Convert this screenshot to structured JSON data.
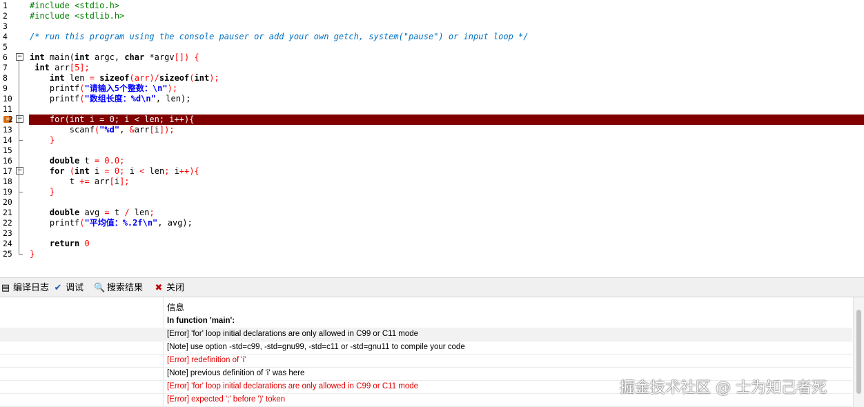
{
  "editor": {
    "lines": [
      {
        "n": "1",
        "segments": [
          {
            "t": "#include <stdio.h>",
            "c": "pp"
          }
        ]
      },
      {
        "n": "2",
        "segments": [
          {
            "t": "#include <stdlib.h>",
            "c": "pp"
          }
        ]
      },
      {
        "n": "3",
        "segments": []
      },
      {
        "n": "4",
        "segments": [
          {
            "t": "/* run this program using the console pauser or add your own getch, system(\"pause\") or input loop */",
            "c": "cm"
          }
        ]
      },
      {
        "n": "5",
        "segments": []
      },
      {
        "n": "6",
        "fold": "−",
        "segments": [
          {
            "t": "int",
            "c": "kw"
          },
          {
            "t": " main(",
            "c": ""
          },
          {
            "t": "int",
            "c": "kw"
          },
          {
            "t": " argc, ",
            "c": ""
          },
          {
            "t": "char",
            "c": "kw"
          },
          {
            "t": " *argv",
            "c": ""
          },
          {
            "t": "[])",
            "c": "sym"
          },
          {
            "t": " {",
            "c": "sym"
          }
        ]
      },
      {
        "n": "7",
        "segments": [
          {
            "t": " ",
            "c": ""
          },
          {
            "t": "int",
            "c": "kw"
          },
          {
            "t": " arr",
            "c": ""
          },
          {
            "t": "[",
            "c": "sym"
          },
          {
            "t": "5",
            "c": "num"
          },
          {
            "t": "];",
            "c": "sym"
          }
        ]
      },
      {
        "n": "8",
        "segments": [
          {
            "t": "    ",
            "c": ""
          },
          {
            "t": "int",
            "c": "kw"
          },
          {
            "t": " len ",
            "c": ""
          },
          {
            "t": "=",
            "c": "sym"
          },
          {
            "t": " ",
            "c": ""
          },
          {
            "t": "sizeof",
            "c": "fn"
          },
          {
            "t": "(arr)",
            "c": "sym"
          },
          {
            "t": "/",
            "c": "sym"
          },
          {
            "t": "sizeof",
            "c": "fn"
          },
          {
            "t": "(",
            "c": "sym"
          },
          {
            "t": "int",
            "c": "kw"
          },
          {
            "t": ");",
            "c": "sym"
          }
        ]
      },
      {
        "n": "9",
        "segments": [
          {
            "t": "    printf",
            "c": ""
          },
          {
            "t": "(",
            "c": "sym"
          },
          {
            "t": "\"请输入5个整数：\\n\"",
            "c": "str"
          },
          {
            "t": ");",
            "c": "sym"
          }
        ]
      },
      {
        "n": "10",
        "segments": [
          {
            "t": "    printf",
            "c": ""
          },
          {
            "t": "(",
            "c": "sym"
          },
          {
            "t": "\"数组长度：%d\\n\"",
            "c": "str"
          },
          {
            "t": ", len);",
            "c": ""
          }
        ]
      },
      {
        "n": "11",
        "segments": []
      },
      {
        "n": "12",
        "fold": "−",
        "error": true,
        "segments": [
          {
            "t": "    for(int i = 0; i < len; i++){",
            "c": ""
          }
        ]
      },
      {
        "n": "13",
        "segments": [
          {
            "t": "        scanf",
            "c": ""
          },
          {
            "t": "(",
            "c": "sym"
          },
          {
            "t": "\"%d\"",
            "c": "str"
          },
          {
            "t": ", ",
            "c": ""
          },
          {
            "t": "&",
            "c": "sym"
          },
          {
            "t": "arr",
            "c": ""
          },
          {
            "t": "[",
            "c": "sym"
          },
          {
            "t": "i",
            "c": ""
          },
          {
            "t": "]);",
            "c": "sym"
          }
        ]
      },
      {
        "n": "14",
        "segments": [
          {
            "t": "    ",
            "c": ""
          },
          {
            "t": "}",
            "c": "sym"
          }
        ]
      },
      {
        "n": "15",
        "segments": []
      },
      {
        "n": "16",
        "segments": [
          {
            "t": "    ",
            "c": ""
          },
          {
            "t": "double",
            "c": "kw"
          },
          {
            "t": " t ",
            "c": ""
          },
          {
            "t": "=",
            "c": "sym"
          },
          {
            "t": " ",
            "c": ""
          },
          {
            "t": "0.0",
            "c": "num"
          },
          {
            "t": ";",
            "c": "sym"
          }
        ]
      },
      {
        "n": "17",
        "fold": "−",
        "segments": [
          {
            "t": "    ",
            "c": ""
          },
          {
            "t": "for",
            "c": "kw"
          },
          {
            "t": " (",
            "c": "sym"
          },
          {
            "t": "int",
            "c": "kw"
          },
          {
            "t": " i ",
            "c": ""
          },
          {
            "t": "=",
            "c": "sym"
          },
          {
            "t": " ",
            "c": ""
          },
          {
            "t": "0",
            "c": "num"
          },
          {
            "t": ";",
            "c": "sym"
          },
          {
            "t": " i ",
            "c": ""
          },
          {
            "t": "<",
            "c": "sym"
          },
          {
            "t": " len",
            "c": ""
          },
          {
            "t": ";",
            "c": "sym"
          },
          {
            "t": " i",
            "c": ""
          },
          {
            "t": "++){",
            "c": "sym"
          }
        ]
      },
      {
        "n": "18",
        "segments": [
          {
            "t": "        t ",
            "c": ""
          },
          {
            "t": "+=",
            "c": "sym"
          },
          {
            "t": " arr",
            "c": ""
          },
          {
            "t": "[",
            "c": "sym"
          },
          {
            "t": "i",
            "c": ""
          },
          {
            "t": "];",
            "c": "sym"
          }
        ]
      },
      {
        "n": "19",
        "segments": [
          {
            "t": "    ",
            "c": ""
          },
          {
            "t": "}",
            "c": "sym"
          }
        ]
      },
      {
        "n": "20",
        "segments": []
      },
      {
        "n": "21",
        "segments": [
          {
            "t": "    ",
            "c": ""
          },
          {
            "t": "double",
            "c": "kw"
          },
          {
            "t": " avg ",
            "c": ""
          },
          {
            "t": "=",
            "c": "sym"
          },
          {
            "t": " t ",
            "c": ""
          },
          {
            "t": "/",
            "c": "sym"
          },
          {
            "t": " len",
            "c": ""
          },
          {
            "t": ";",
            "c": "sym"
          }
        ]
      },
      {
        "n": "22",
        "segments": [
          {
            "t": "    printf",
            "c": ""
          },
          {
            "t": "(",
            "c": "sym"
          },
          {
            "t": "\"平均值：%.2f\\n\"",
            "c": "str"
          },
          {
            "t": ", avg);",
            "c": ""
          }
        ]
      },
      {
        "n": "23",
        "segments": []
      },
      {
        "n": "24",
        "segments": [
          {
            "t": "    ",
            "c": ""
          },
          {
            "t": "return",
            "c": "kw"
          },
          {
            "t": " ",
            "c": ""
          },
          {
            "t": "0",
            "c": "num"
          }
        ]
      },
      {
        "n": "25",
        "segments": [
          {
            "t": "}",
            "c": "sym"
          }
        ]
      }
    ]
  },
  "tabs": [
    {
      "label": "编译日志",
      "icon": "compile-log-icon",
      "glyph": "▤"
    },
    {
      "label": "调试",
      "icon": "debug-check-icon",
      "glyph": "✔"
    },
    {
      "label": "搜索结果",
      "icon": "search-results-icon",
      "glyph": "🔍"
    },
    {
      "label": "关闭",
      "icon": "close-panel-icon",
      "glyph": "✖"
    }
  ],
  "results": {
    "header": "信息",
    "rows": [
      {
        "text": "In function 'main':",
        "kind": "bold"
      },
      {
        "text": "[Error] 'for' loop initial declarations are only allowed in C99 or C11 mode",
        "kind": "normal",
        "selected": true
      },
      {
        "text": "[Note] use option -std=c99, -std=gnu99, -std=c11 or -std=gnu11 to compile your code",
        "kind": "normal"
      },
      {
        "text": "[Error] redefinition of 'i'",
        "kind": "err"
      },
      {
        "text": "[Note] previous definition of 'i' was here",
        "kind": "normal"
      },
      {
        "text": "[Error] 'for' loop initial declarations are only allowed in C99 or C11 mode",
        "kind": "err"
      },
      {
        "text": "[Error] expected ';' before ')' token",
        "kind": "err"
      }
    ]
  },
  "watermark": "掘金技术社区 @ 士为知己者死",
  "colors": {
    "error_line_bg": "#800000",
    "error_text": "#e00000",
    "comment": "#0070c0",
    "preprocessor": "#008000",
    "string": "#0000ff"
  }
}
